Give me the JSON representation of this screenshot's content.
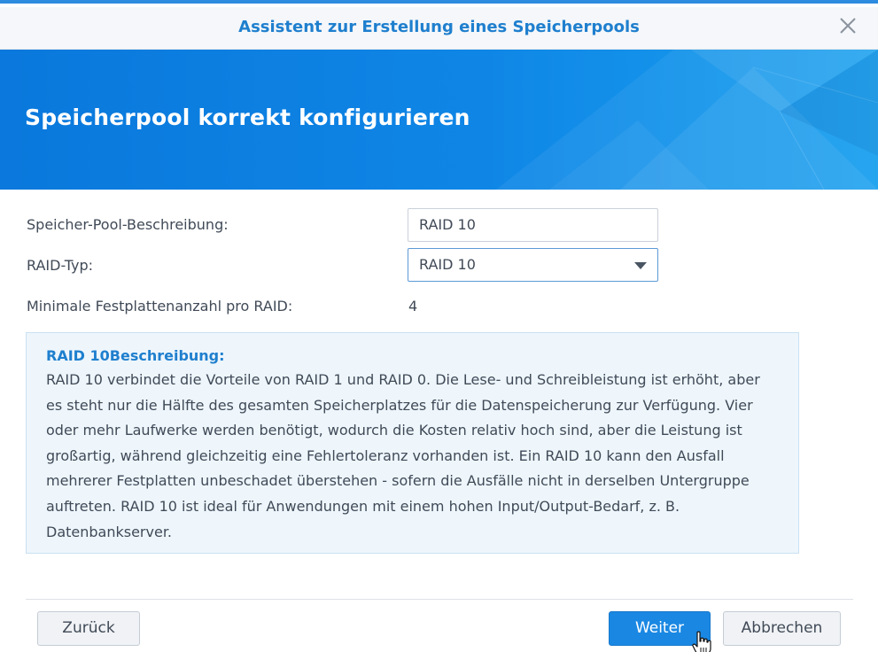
{
  "window": {
    "title": "Assistent zur Erstellung eines Speicherpools",
    "close_icon": "close-icon"
  },
  "banner": {
    "heading": "Speicherpool korrekt konfigurieren"
  },
  "form": {
    "description_label": "Speicher-Pool-Beschreibung:",
    "description_value": "RAID 10",
    "raid_type_label": "RAID-Typ:",
    "raid_type_value": "RAID 10",
    "min_disks_label": "Minimale Festplattenanzahl pro RAID:",
    "min_disks_value": "4"
  },
  "info": {
    "heading": "RAID 10Beschreibung:",
    "text": "RAID 10 verbindet die Vorteile von RAID 1 und RAID 0. Die Lese- und Schreibleistung ist erhöht, aber es steht nur die Hälfte des gesamten Speicherplatzes für die Datenspeicherung zur Verfügung. Vier oder mehr Laufwerke werden benötigt, wodurch die Kosten relativ hoch sind, aber die Leistung ist großartig, während gleichzeitig eine Fehlertoleranz vorhanden ist. Ein RAID 10 kann den Ausfall mehrerer Festplatten unbeschadet überstehen - sofern die Ausfälle nicht in derselben Untergruppe auftreten. RAID 10 ist ideal für Anwendungen mit einem hohen Input/Output-Bedarf, z. B. Datenbankserver."
  },
  "footer": {
    "back_label": "Zurück",
    "next_label": "Weiter",
    "cancel_label": "Abbrechen"
  },
  "colors": {
    "accent": "#1f7fce",
    "banner": "#0f86e6",
    "primary_button": "#1a88e3",
    "info_background": "#eef6fc"
  }
}
